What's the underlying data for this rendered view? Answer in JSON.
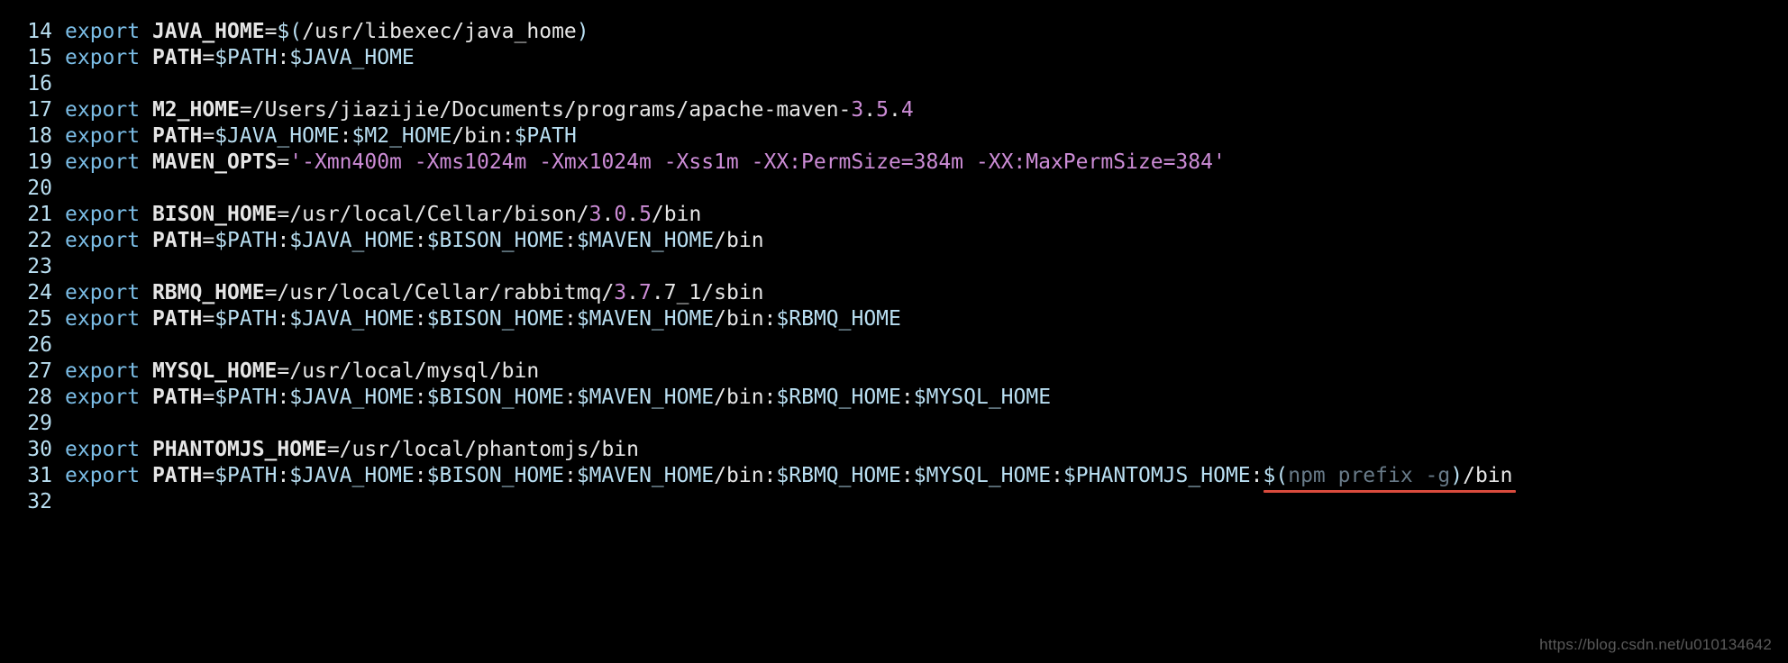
{
  "watermark": "https://blog.csdn.net/u010134642",
  "lines": [
    {
      "n": "14",
      "tokens": [
        {
          "t": "export ",
          "c": "kw"
        },
        {
          "t": "JAVA_HOME",
          "c": "var"
        },
        {
          "t": "=",
          "c": "eq"
        },
        {
          "t": "$(",
          "c": "sh"
        },
        {
          "t": "/usr/libexec/java_home",
          "c": "path"
        },
        {
          "t": ")",
          "c": "sh"
        }
      ]
    },
    {
      "n": "15",
      "tokens": [
        {
          "t": "export ",
          "c": "kw"
        },
        {
          "t": "PATH",
          "c": "var"
        },
        {
          "t": "=",
          "c": "eq"
        },
        {
          "t": "$PATH",
          "c": "dvar"
        },
        {
          "t": ":",
          "c": "path"
        },
        {
          "t": "$JAVA_HOME",
          "c": "dvar"
        }
      ]
    },
    {
      "n": "16",
      "tokens": []
    },
    {
      "n": "17",
      "tokens": [
        {
          "t": "export ",
          "c": "kw"
        },
        {
          "t": "M2_HOME",
          "c": "var"
        },
        {
          "t": "=",
          "c": "eq"
        },
        {
          "t": "/Users/jiazijie/Documents/programs/apache-maven-",
          "c": "path"
        },
        {
          "t": "3",
          "c": "num"
        },
        {
          "t": ".",
          "c": "path"
        },
        {
          "t": "5",
          "c": "num"
        },
        {
          "t": ".",
          "c": "path"
        },
        {
          "t": "4",
          "c": "num"
        }
      ]
    },
    {
      "n": "18",
      "tokens": [
        {
          "t": "export ",
          "c": "kw"
        },
        {
          "t": "PATH",
          "c": "var"
        },
        {
          "t": "=",
          "c": "eq"
        },
        {
          "t": "$JAVA_HOME",
          "c": "dvar"
        },
        {
          "t": ":",
          "c": "path"
        },
        {
          "t": "$M2_HOME",
          "c": "dvar"
        },
        {
          "t": "/bin:",
          "c": "path"
        },
        {
          "t": "$PATH",
          "c": "dvar"
        }
      ]
    },
    {
      "n": "19",
      "tokens": [
        {
          "t": "export ",
          "c": "kw"
        },
        {
          "t": "MAVEN_OPTS",
          "c": "var"
        },
        {
          "t": "=",
          "c": "eq"
        },
        {
          "t": "'-Xmn400m -Xms1024m -Xmx1024m -Xss1m -XX:PermSize=384m -XX:MaxPermSize=384'",
          "c": "str"
        }
      ]
    },
    {
      "n": "20",
      "tokens": []
    },
    {
      "n": "21",
      "tokens": [
        {
          "t": "export ",
          "c": "kw"
        },
        {
          "t": "BISON_HOME",
          "c": "var"
        },
        {
          "t": "=",
          "c": "eq"
        },
        {
          "t": "/usr/local/Cellar/bison/",
          "c": "path"
        },
        {
          "t": "3",
          "c": "num"
        },
        {
          "t": ".",
          "c": "path"
        },
        {
          "t": "0",
          "c": "num"
        },
        {
          "t": ".",
          "c": "path"
        },
        {
          "t": "5",
          "c": "num"
        },
        {
          "t": "/bin",
          "c": "path"
        }
      ]
    },
    {
      "n": "22",
      "tokens": [
        {
          "t": "export ",
          "c": "kw"
        },
        {
          "t": "PATH",
          "c": "var"
        },
        {
          "t": "=",
          "c": "eq"
        },
        {
          "t": "$PATH",
          "c": "dvar"
        },
        {
          "t": ":",
          "c": "path"
        },
        {
          "t": "$JAVA_HOME",
          "c": "dvar"
        },
        {
          "t": ":",
          "c": "path"
        },
        {
          "t": "$BISON_HOME",
          "c": "dvar"
        },
        {
          "t": ":",
          "c": "path"
        },
        {
          "t": "$MAVEN_HOME",
          "c": "dvar"
        },
        {
          "t": "/bin",
          "c": "path"
        }
      ]
    },
    {
      "n": "23",
      "tokens": []
    },
    {
      "n": "24",
      "tokens": [
        {
          "t": "export ",
          "c": "kw"
        },
        {
          "t": "RBMQ_HOME",
          "c": "var"
        },
        {
          "t": "=",
          "c": "eq"
        },
        {
          "t": "/usr/local/Cellar/rabbitmq/",
          "c": "path"
        },
        {
          "t": "3",
          "c": "num"
        },
        {
          "t": ".",
          "c": "path"
        },
        {
          "t": "7",
          "c": "num"
        },
        {
          "t": ".",
          "c": "path"
        },
        {
          "t": "7_1",
          "c": "path"
        },
        {
          "t": "/sbin",
          "c": "path"
        }
      ]
    },
    {
      "n": "25",
      "tokens": [
        {
          "t": "export ",
          "c": "kw"
        },
        {
          "t": "PATH",
          "c": "var"
        },
        {
          "t": "=",
          "c": "eq"
        },
        {
          "t": "$PATH",
          "c": "dvar"
        },
        {
          "t": ":",
          "c": "path"
        },
        {
          "t": "$JAVA_HOME",
          "c": "dvar"
        },
        {
          "t": ":",
          "c": "path"
        },
        {
          "t": "$BISON_HOME",
          "c": "dvar"
        },
        {
          "t": ":",
          "c": "path"
        },
        {
          "t": "$MAVEN_HOME",
          "c": "dvar"
        },
        {
          "t": "/bin:",
          "c": "path"
        },
        {
          "t": "$RBMQ_HOME",
          "c": "dvar"
        }
      ]
    },
    {
      "n": "26",
      "tokens": []
    },
    {
      "n": "27",
      "tokens": [
        {
          "t": "export ",
          "c": "kw"
        },
        {
          "t": "MYSQL_HOME",
          "c": "var"
        },
        {
          "t": "=",
          "c": "eq"
        },
        {
          "t": "/usr/local/mysql/bin",
          "c": "path"
        }
      ]
    },
    {
      "n": "28",
      "tokens": [
        {
          "t": "export ",
          "c": "kw"
        },
        {
          "t": "PATH",
          "c": "var"
        },
        {
          "t": "=",
          "c": "eq"
        },
        {
          "t": "$PATH",
          "c": "dvar"
        },
        {
          "t": ":",
          "c": "path"
        },
        {
          "t": "$JAVA_HOME",
          "c": "dvar"
        },
        {
          "t": ":",
          "c": "path"
        },
        {
          "t": "$BISON_HOME",
          "c": "dvar"
        },
        {
          "t": ":",
          "c": "path"
        },
        {
          "t": "$MAVEN_HOME",
          "c": "dvar"
        },
        {
          "t": "/bin:",
          "c": "path"
        },
        {
          "t": "$RBMQ_HOME",
          "c": "dvar"
        },
        {
          "t": ":",
          "c": "path"
        },
        {
          "t": "$MYSQL_HOME",
          "c": "dvar"
        }
      ]
    },
    {
      "n": "29",
      "tokens": []
    },
    {
      "n": "30",
      "tokens": [
        {
          "t": "export ",
          "c": "kw"
        },
        {
          "t": "PHANTOMJS_HOME",
          "c": "var"
        },
        {
          "t": "=",
          "c": "eq"
        },
        {
          "t": "/usr/local/phantomjs/bin",
          "c": "path"
        }
      ]
    },
    {
      "n": "31",
      "tokens": [
        {
          "t": "export ",
          "c": "kw"
        },
        {
          "t": "PATH",
          "c": "var"
        },
        {
          "t": "=",
          "c": "eq"
        },
        {
          "t": "$PATH",
          "c": "dvar"
        },
        {
          "t": ":",
          "c": "path"
        },
        {
          "t": "$JAVA_HOME",
          "c": "dvar"
        },
        {
          "t": ":",
          "c": "path"
        },
        {
          "t": "$BISON_HOME",
          "c": "dvar"
        },
        {
          "t": ":",
          "c": "path"
        },
        {
          "t": "$MAVEN_HOME",
          "c": "dvar"
        },
        {
          "t": "/bin:",
          "c": "path"
        },
        {
          "t": "$RBMQ_HOME",
          "c": "dvar"
        },
        {
          "t": ":",
          "c": "path"
        },
        {
          "t": "$MYSQL_HOME",
          "c": "dvar"
        },
        {
          "t": ":",
          "c": "path"
        },
        {
          "t": "$PHANTOMJS_HOME",
          "c": "dvar"
        },
        {
          "t": ":",
          "c": "path"
        },
        {
          "t": "$(",
          "c": "sh",
          "u": true
        },
        {
          "t": "npm prefix -g",
          "c": "dim",
          "u": true
        },
        {
          "t": ")",
          "c": "sh",
          "u": true
        },
        {
          "t": "/bin",
          "c": "path",
          "u": true
        }
      ]
    },
    {
      "n": "32",
      "tokens": []
    }
  ]
}
